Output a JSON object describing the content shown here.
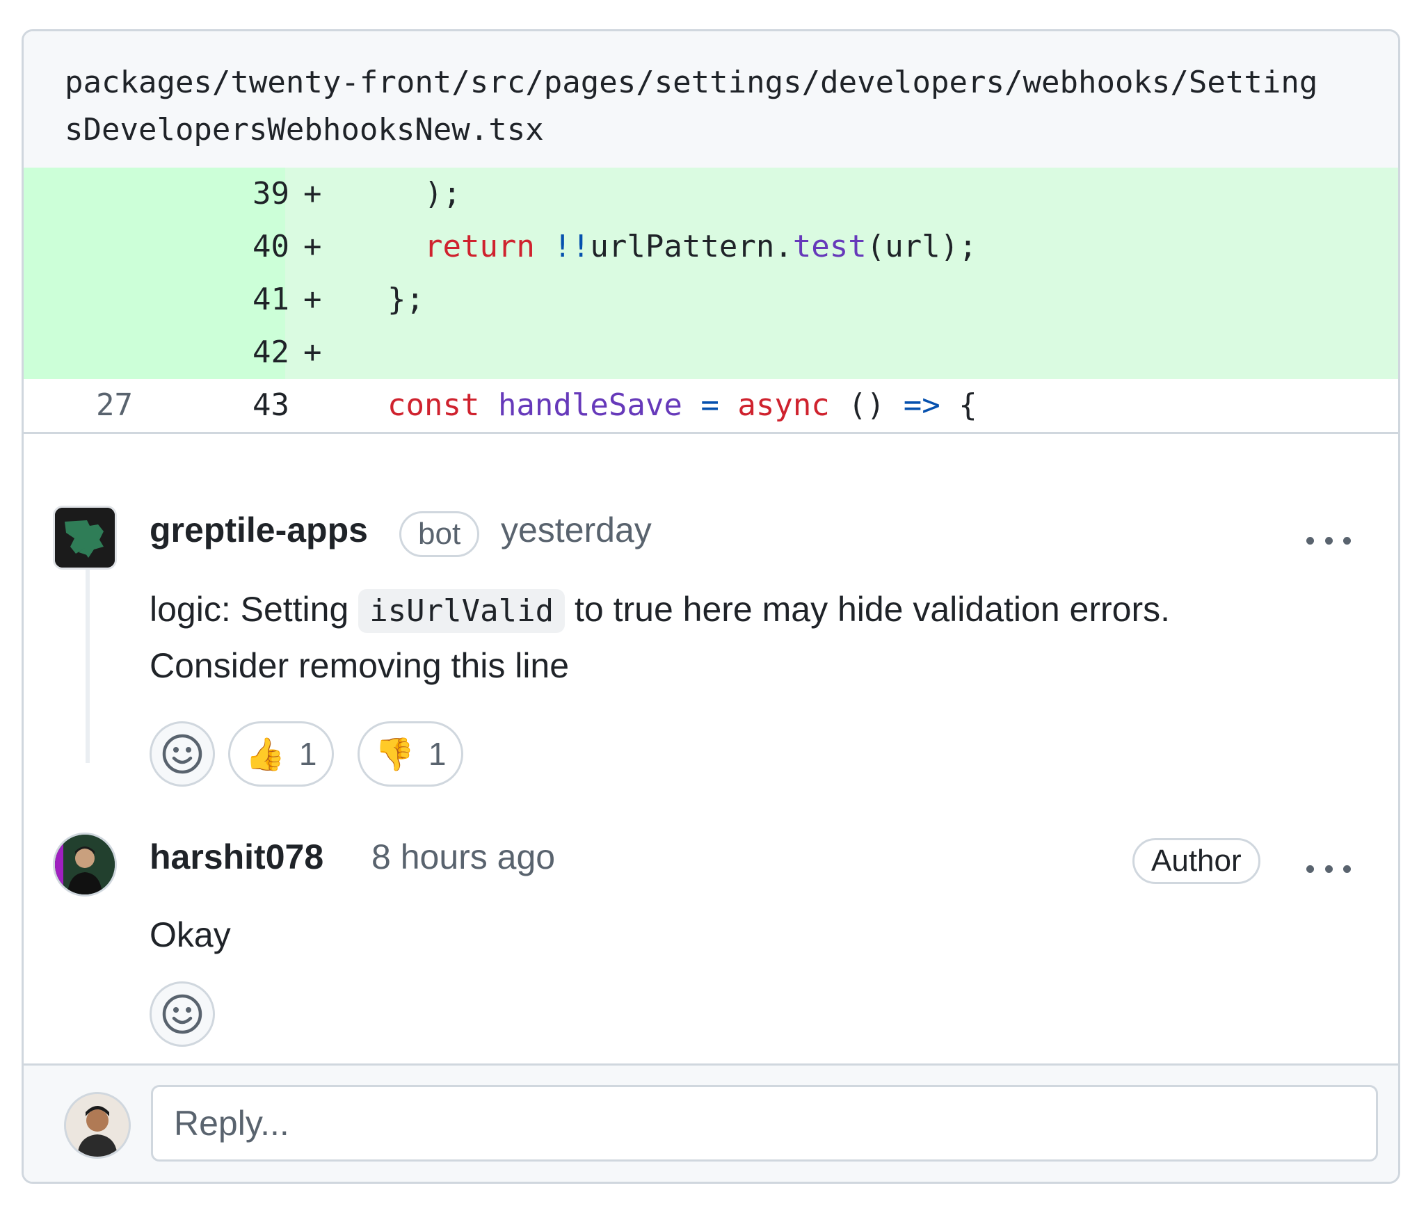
{
  "file": {
    "path": "packages/twenty-front/src/pages/settings/developers/webhooks/SettingsDevelopersWebhooksNew.tsx"
  },
  "diff": {
    "rows": [
      {
        "old": "",
        "new": "39",
        "marker": "+"
      },
      {
        "old": "",
        "new": "40",
        "marker": "+"
      },
      {
        "old": "",
        "new": "41",
        "marker": "+"
      },
      {
        "old": "",
        "new": "42",
        "marker": "+"
      },
      {
        "old": "27",
        "new": "43",
        "marker": ""
      }
    ],
    "code": {
      "l39": ");",
      "l40_kw": "return",
      "l40_op": "!!",
      "l40_obj": "urlPattern.",
      "l40_fn": "test",
      "l40_rest": "(url);",
      "l41": "};",
      "l43_kw": "const",
      "l43_fn": "handleSave",
      "l43_eq": "=",
      "l43_kw2": "async",
      "l43_paren": "()",
      "l43_arrow": "=>",
      "l43_brace": "{"
    }
  },
  "comments": [
    {
      "author": "greptile-apps",
      "badge": "bot",
      "time": "yesterday",
      "body_before": "logic: Setting",
      "body_code": "isUrlValid",
      "body_after": "to true here may hide validation errors.",
      "body_line2": "Consider removing this line",
      "reactions": [
        {
          "emoji": "👍",
          "count": "1"
        },
        {
          "emoji": "👎",
          "count": "1"
        }
      ]
    },
    {
      "author": "harshit078",
      "time": "8 hours ago",
      "badge": "Author",
      "body": "Okay"
    }
  ],
  "reply": {
    "placeholder": "Reply..."
  },
  "icons": {
    "add_reaction": "smiley-icon",
    "more": "kebab-horizontal-icon"
  },
  "colors": {
    "added_line_bg": "#dafbe1",
    "keyword": "#cf222e",
    "function": "#6639ba",
    "operator": "#0550ae"
  }
}
